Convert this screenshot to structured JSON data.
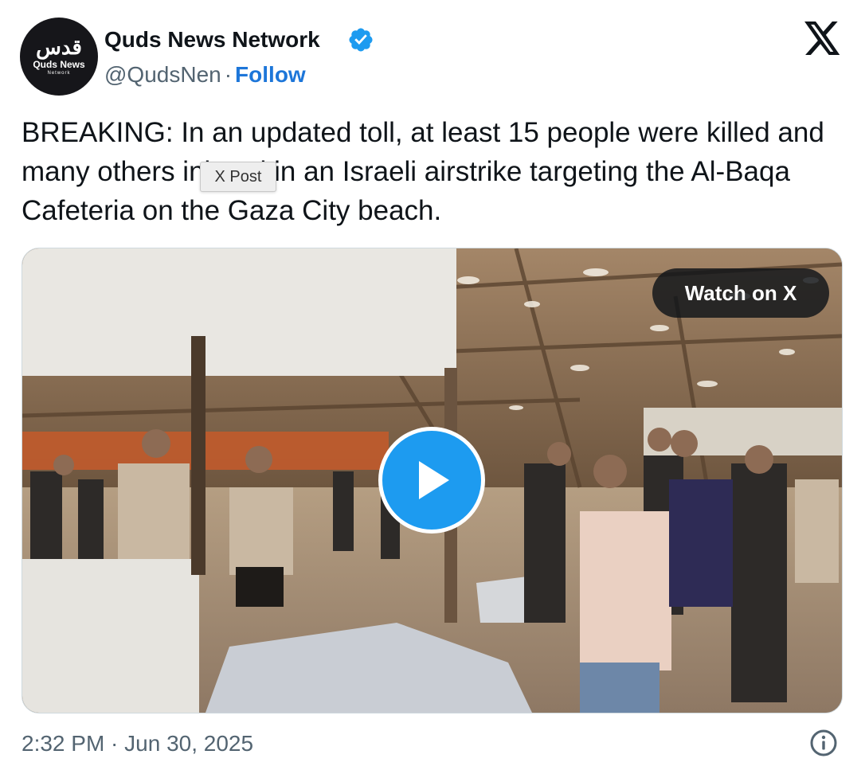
{
  "author": {
    "logo_script": "قدس",
    "logo_name": "Quds News",
    "logo_sub": "Network",
    "name": "Quds News Network",
    "handle": "@QudsNen",
    "separator": "·",
    "follow_label": "Follow",
    "verified": true,
    "verified_color": "#1d9bf0"
  },
  "tweet": {
    "text": "BREAKING: In an updated toll, at least 15 people were killed and many others injured in an Israeli airstrike targeting the Al-Baqa Cafeteria on the Gaza City beach."
  },
  "tooltip": {
    "label": "X Post"
  },
  "media": {
    "type": "video",
    "watch_label": "Watch on X",
    "play_color": "#1d9bf0"
  },
  "footer": {
    "timestamp": "2:32 PM · Jun 30, 2025",
    "info_icon": "info-icon"
  },
  "icons": {
    "close": "x-logo-icon",
    "verified": "verified-badge-icon",
    "play": "play-icon"
  }
}
